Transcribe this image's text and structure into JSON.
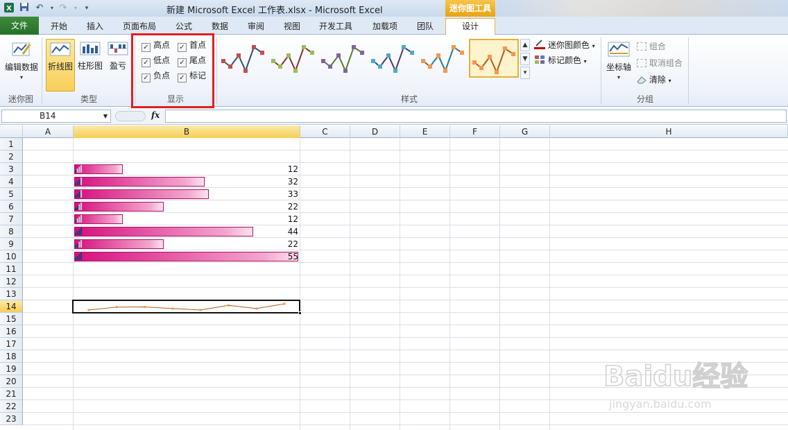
{
  "window": {
    "title": "新建 Microsoft Excel 工作表.xlsx  -  Microsoft Excel",
    "context_group": "迷你图工具"
  },
  "tabs": {
    "file": "文件",
    "items": [
      "开始",
      "插入",
      "页面布局",
      "公式",
      "数据",
      "审阅",
      "视图",
      "开发工具",
      "加载项",
      "团队"
    ],
    "design": "设计"
  },
  "ribbon": {
    "sparkline_group": {
      "edit_data": "编辑数据",
      "label": "迷你图"
    },
    "type_group": {
      "line": "折线图",
      "column": "柱形图",
      "winloss": "盈亏",
      "label": "类型"
    },
    "show_group": {
      "label": "显示",
      "options": [
        {
          "label": "高点",
          "checked": true
        },
        {
          "label": "首点",
          "checked": true
        },
        {
          "label": "低点",
          "checked": true
        },
        {
          "label": "尾点",
          "checked": true
        },
        {
          "label": "负点",
          "checked": true
        },
        {
          "label": "标记",
          "checked": true
        }
      ]
    },
    "style_group": {
      "label": "样式",
      "sparkline_color": "迷你图颜色",
      "marker_color": "标记颜色",
      "thumb_colors": [
        {
          "line": "#2f4f75",
          "marker": "#c0504d"
        },
        {
          "line": "#8a2e2e",
          "marker": "#9bbb59"
        },
        {
          "line": "#5f7a2a",
          "marker": "#8064a2"
        },
        {
          "line": "#4b3a6e",
          "marker": "#4bacc6"
        },
        {
          "line": "#2d7a8a",
          "marker": "#f79646"
        },
        {
          "line": "#b05a1a",
          "marker": "#f79646"
        }
      ]
    },
    "group_group": {
      "label": "分组",
      "axis": "坐标轴",
      "group": "组合",
      "ungroup": "取消组合",
      "clear": "清除"
    }
  },
  "formula_bar": {
    "name_box": "B14",
    "fx": "fx",
    "value": ""
  },
  "sheet": {
    "columns": [
      "A",
      "B",
      "C",
      "D",
      "E",
      "F",
      "G",
      "H"
    ],
    "rows": [
      "1",
      "2",
      "3",
      "4",
      "5",
      "6",
      "7",
      "8",
      "9",
      "10",
      "11",
      "12",
      "13",
      "14",
      "15",
      "16",
      "17",
      "18",
      "19",
      "20",
      "21",
      "22",
      "23"
    ],
    "selected_column": "B",
    "selected_row": "14",
    "values": [
      {
        "row": 3,
        "value": 12
      },
      {
        "row": 4,
        "value": 32
      },
      {
        "row": 5,
        "value": 33
      },
      {
        "row": 6,
        "value": 22
      },
      {
        "row": 7,
        "value": 12
      },
      {
        "row": 8,
        "value": 44
      },
      {
        "row": 9,
        "value": 22
      },
      {
        "row": 10,
        "value": 55
      }
    ],
    "bar_max": 55,
    "bar_color": "#d60f7e",
    "sparkline": {
      "row": 14,
      "values": [
        12,
        32,
        33,
        22,
        12,
        44,
        22,
        55
      ],
      "line_color": "#b05a1a",
      "marker_color": "#f79646"
    }
  },
  "watermark": {
    "brand": "Baidu经验",
    "url": "jingyan.baidu.com"
  }
}
